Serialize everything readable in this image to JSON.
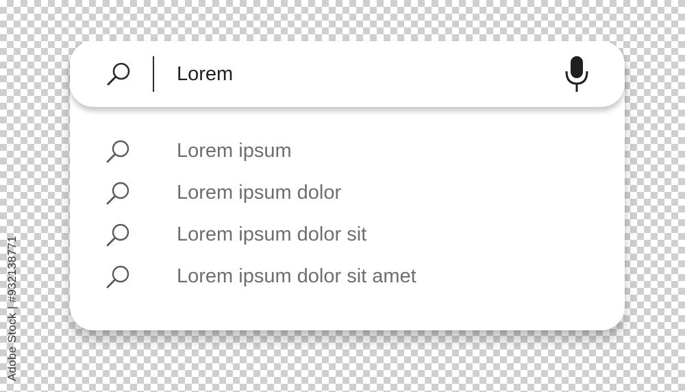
{
  "search": {
    "query": "Lorem",
    "leading_icon": "search-icon",
    "trailing_icon": "microphone-icon"
  },
  "suggestions": [
    {
      "label": "Lorem ipsum",
      "icon": "search-icon"
    },
    {
      "label": "Lorem ipsum dolor",
      "icon": "search-icon"
    },
    {
      "label": "Lorem ipsum dolor sit",
      "icon": "search-icon"
    },
    {
      "label": "Lorem ipsum dolor sit amet",
      "icon": "search-icon"
    }
  ],
  "side_label": "Adobe Stock | #932138771",
  "colors": {
    "query_text": "#1f1f1f",
    "suggestion_text": "#6e6e6e",
    "icon": "#2a2a2a",
    "checker": "#cfcfcf"
  }
}
